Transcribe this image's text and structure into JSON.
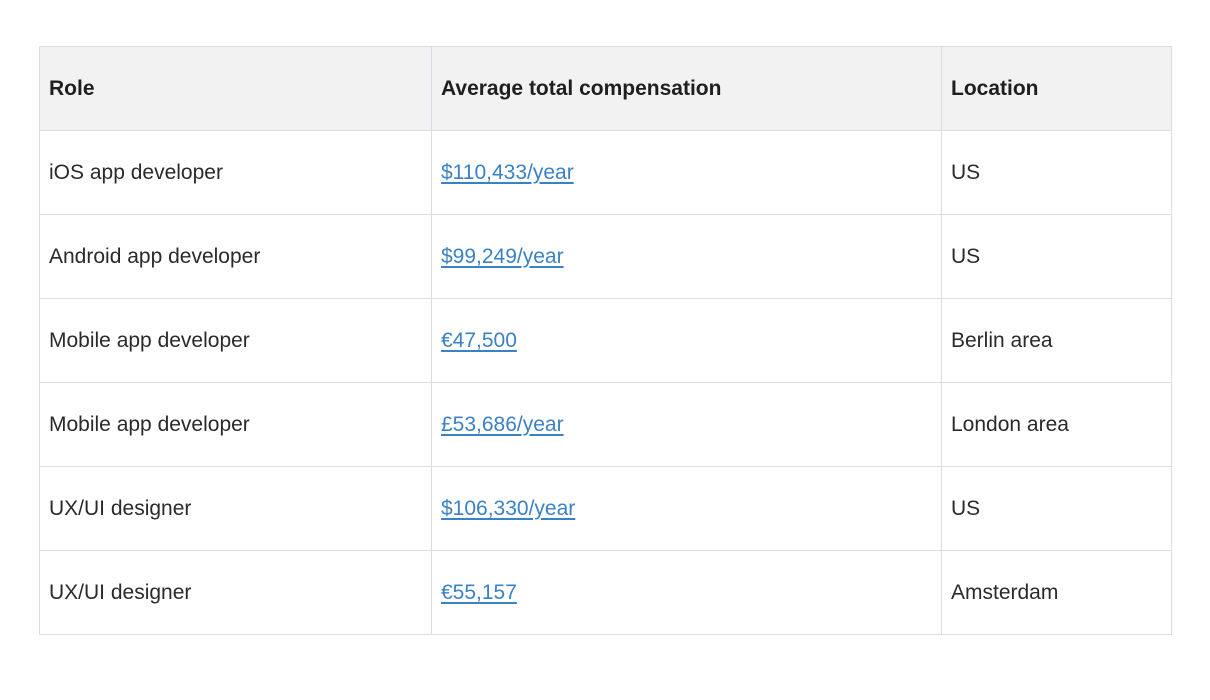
{
  "table": {
    "headers": {
      "role": "Role",
      "compensation": "Average total compensation",
      "location": "Location"
    },
    "rows": [
      {
        "role": "iOS app developer",
        "compensation": "$110,433/year",
        "location": "US"
      },
      {
        "role": "Android app developer",
        "compensation": "$99,249/year",
        "location": "US"
      },
      {
        "role": "Mobile app developer",
        "compensation": "€47,500",
        "location": "Berlin area"
      },
      {
        "role": "Mobile app developer",
        "compensation": "£53,686/year",
        "location": "London area"
      },
      {
        "role": "UX/UI designer",
        "compensation": "$106,330/year",
        "location": "US"
      },
      {
        "role": "UX/UI designer",
        "compensation": "€55,157",
        "location": "Amsterdam"
      }
    ]
  },
  "colors": {
    "link": "#3b82c4",
    "header_bg": "#f2f2f2",
    "border": "#d9dde3"
  }
}
